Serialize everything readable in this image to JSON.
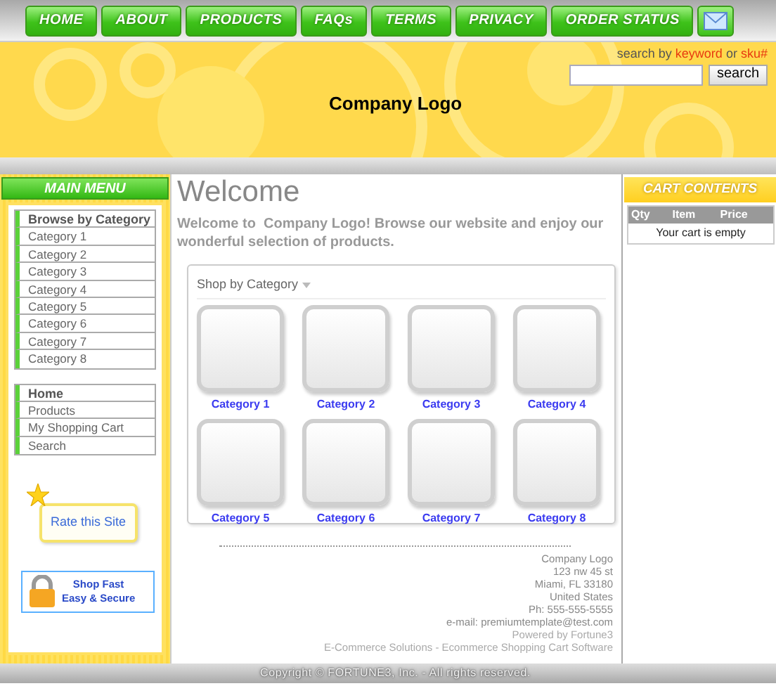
{
  "nav": [
    {
      "label": "HOME"
    },
    {
      "label": "ABOUT"
    },
    {
      "label": "PRODUCTS"
    },
    {
      "label": "FAQs"
    },
    {
      "label": "TERMS"
    },
    {
      "label": "PRIVACY"
    },
    {
      "label": "ORDER STATUS"
    }
  ],
  "header": {
    "logo": "Company Logo",
    "search_hint": [
      {
        "text": "search by",
        "highlight": false
      },
      {
        "text": "keyword",
        "highlight": true
      },
      {
        "text": "or",
        "highlight": false
      },
      {
        "text": "sku#",
        "highlight": true
      }
    ],
    "search_button": "search"
  },
  "sidebar": {
    "title": "MAIN MENU",
    "menus": [
      {
        "heading": "Browse by Category",
        "items": [
          "Category 1",
          "Category 2",
          "Category 3",
          "Category 4",
          "Category 5",
          "Category 6",
          "Category 7",
          "Category 8"
        ]
      },
      {
        "heading": "Home",
        "items": [
          "Products",
          "My Shopping Cart",
          "Search"
        ]
      }
    ],
    "rate": "Rate this Site",
    "secure": [
      "Shop Fast",
      "Easy & Secure"
    ]
  },
  "main": {
    "title": "Welcome",
    "intro": "Welcome to  Company Logo! Browse our website and enjoy our wonderful selection of products.",
    "shop_title": "Shop by Category",
    "categories": [
      "Category 1",
      "Category 2",
      "Category 3",
      "Category 4",
      "Category 5",
      "Category 6",
      "Category 7",
      "Category 8"
    ],
    "address": [
      "Company Logo",
      "123 nw 45 st",
      "Miami, FL 33180",
      "United States",
      "Ph: 555-555-5555"
    ],
    "email_label": "e-mail:",
    "email": "premiumtemplate@test.com",
    "powered": "Powered by Fortune3",
    "software": "E-Commerce Solutions - Ecommerce Shopping Cart Software"
  },
  "cart": {
    "title": "CART CONTENTS",
    "columns": [
      "Qty",
      "Item",
      "Price"
    ],
    "empty": "Your cart is empty"
  },
  "copyright": "Copyright © FORTUNE3, Inc. - All rights reserved."
}
